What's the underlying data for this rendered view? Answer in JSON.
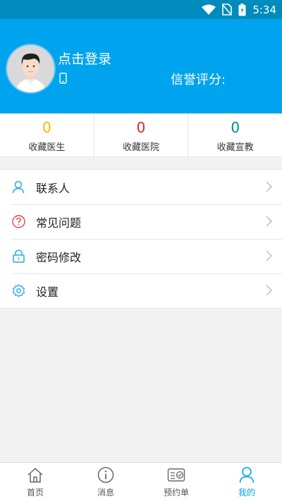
{
  "status_bar": {
    "time": "5:34",
    "icons": [
      "wifi-icon",
      "no-sim-icon",
      "battery-icon"
    ]
  },
  "header": {
    "login_text": "点击登录",
    "credit_label": "信誉评分:",
    "phone_icon": "phone-icon",
    "avatar_icon": "avatar"
  },
  "stats": [
    {
      "value": "0",
      "label": "收藏医生",
      "color": "#f5b800"
    },
    {
      "value": "0",
      "label": "收藏医院",
      "color": "#d9262c"
    },
    {
      "value": "0",
      "label": "收藏宣教",
      "color": "#008c8c"
    }
  ],
  "menu": [
    {
      "label": "联系人",
      "icon": "person-icon"
    },
    {
      "label": "常见问题",
      "icon": "question-icon"
    },
    {
      "label": "密码修改",
      "icon": "lock-icon"
    },
    {
      "label": "设置",
      "icon": "gear-icon"
    }
  ],
  "tabs": [
    {
      "label": "首页",
      "icon": "home-icon",
      "active": false
    },
    {
      "label": "消息",
      "icon": "info-icon",
      "active": false
    },
    {
      "label": "预约单",
      "icon": "appointment-icon",
      "active": false
    },
    {
      "label": "我的",
      "icon": "profile-icon",
      "active": true
    }
  ],
  "colors": {
    "status_bar": "#008bbd",
    "header": "#00a3ee",
    "accent": "#00a3ee",
    "background": "#f2f2f2"
  }
}
